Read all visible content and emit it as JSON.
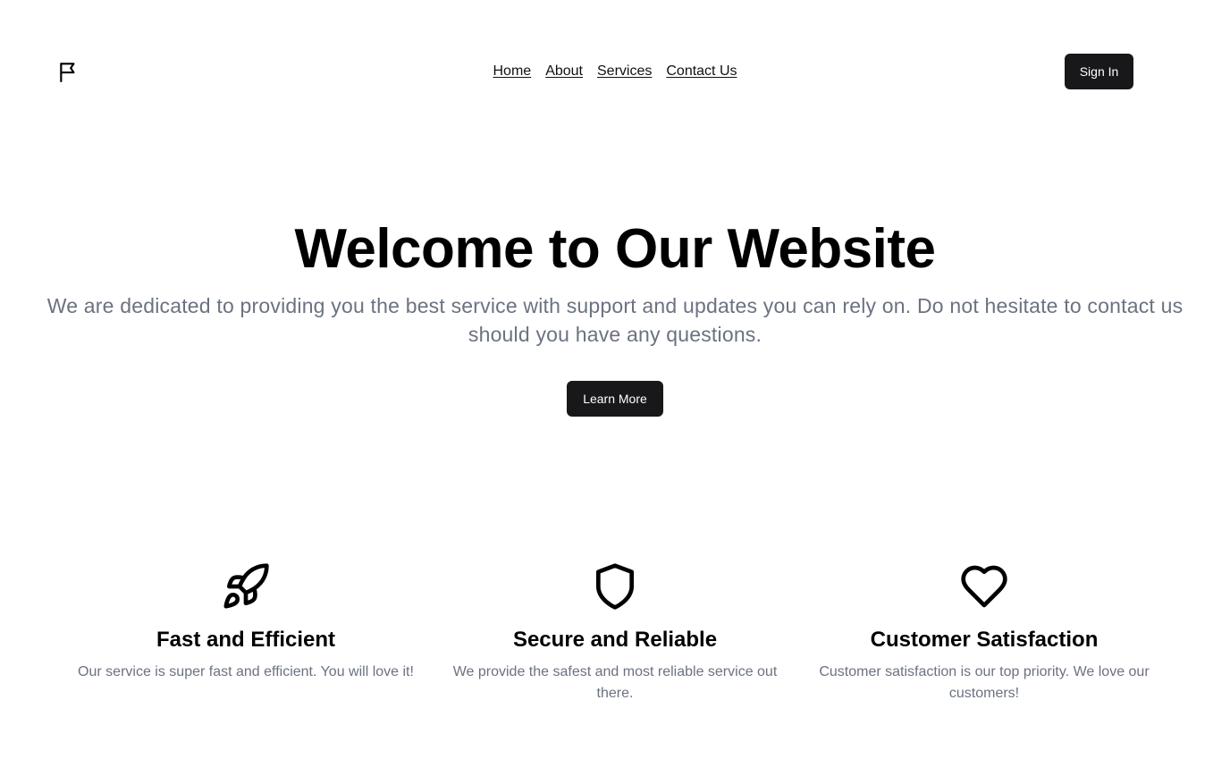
{
  "header": {
    "logo_icon": "flag-icon",
    "nav": [
      {
        "label": "Home"
      },
      {
        "label": "About"
      },
      {
        "label": "Services"
      },
      {
        "label": "Contact Us"
      }
    ],
    "signin_label": "Sign In"
  },
  "hero": {
    "title": "Welcome to Our Website",
    "subtitle": "We are dedicated to providing you the best service with support and updates you can rely on. Do not hesitate to contact us should you have any questions.",
    "cta_label": "Learn More"
  },
  "features": [
    {
      "icon": "rocket-icon",
      "title": "Fast and Efficient",
      "text": "Our service is super fast and efficient. You will love it!"
    },
    {
      "icon": "shield-icon",
      "title": "Secure and Reliable",
      "text": "We provide the safest and most reliable service out there."
    },
    {
      "icon": "heart-icon",
      "title": "Customer Satisfaction",
      "text": "Customer satisfaction is our top priority. We love our customers!"
    }
  ],
  "colors": {
    "button_bg": "#18181b",
    "muted_text": "#6b7280"
  }
}
